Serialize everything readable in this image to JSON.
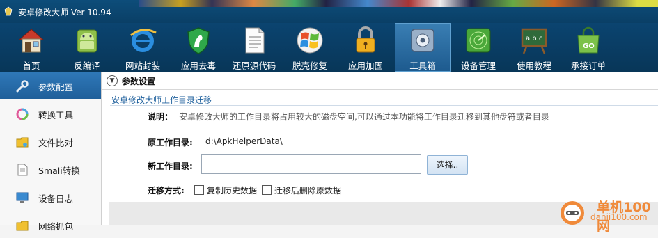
{
  "window": {
    "title": "安卓修改大师 Ver 10.94"
  },
  "toolbar": {
    "items": [
      {
        "label": "首页",
        "icon": "home-icon"
      },
      {
        "label": "反编译",
        "icon": "android-icon"
      },
      {
        "label": "网站封装",
        "icon": "ie-browser-icon"
      },
      {
        "label": "应用去毒",
        "icon": "shield-icon"
      },
      {
        "label": "还原源代码",
        "icon": "document-icon"
      },
      {
        "label": "脱壳修复",
        "icon": "windows-icon"
      },
      {
        "label": "应用加固",
        "icon": "lock-icon"
      },
      {
        "label": "工具箱",
        "icon": "toolbox-icon"
      },
      {
        "label": "设备管理",
        "icon": "radar-icon"
      },
      {
        "label": "使用教程",
        "icon": "chalkboard-icon"
      },
      {
        "label": "承接订单",
        "icon": "shopping-bag-icon"
      }
    ],
    "active_index": 7
  },
  "sidebar": {
    "items": [
      {
        "label": "参数配置",
        "icon": "wrench-icon"
      },
      {
        "label": "转换工具",
        "icon": "convert-icon"
      },
      {
        "label": "文件比对",
        "icon": "folder-compare-icon"
      },
      {
        "label": "Smali转换",
        "icon": "file-icon"
      },
      {
        "label": "设备日志",
        "icon": "monitor-icon"
      },
      {
        "label": "网络抓包",
        "icon": "folder-icon"
      }
    ],
    "active_index": 0
  },
  "main": {
    "section_title": "参数设置",
    "group_title": "安卓修改大师工作目录迁移",
    "desc_label": "说明：",
    "desc_text": "安卓修改大师的工作目录将占用较大的磁盘空间,可以通过本功能将工作目录迁移到其他盘符或者目录",
    "orig_dir_label": "原工作目录:",
    "orig_dir_value": "d:\\ApkHelperData\\",
    "new_dir_label": "新工作目录:",
    "new_dir_value": "",
    "choose_button": "选择..",
    "mode_label": "迁移方式:",
    "option_copy": "复制历史数据",
    "option_delete": "迁移后删除原数据"
  },
  "watermark": {
    "text": "单机100网",
    "url_text": "danji100.com"
  }
}
